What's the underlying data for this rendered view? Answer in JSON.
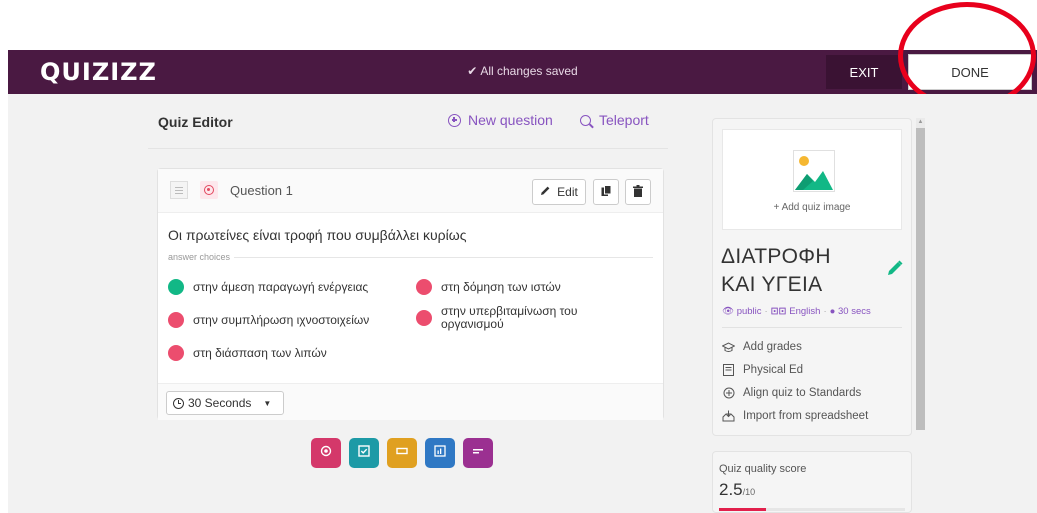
{
  "header": {
    "logo": "QUIZIZZ",
    "save_status": "All changes saved",
    "exit_label": "EXIT",
    "done_label": "DONE"
  },
  "editor": {
    "title": "Quiz Editor",
    "new_question_label": "New question",
    "teleport_label": "Teleport"
  },
  "question": {
    "label": "Question 1",
    "edit_label": "Edit",
    "text": "Οι πρωτείνες είναι τροφή που συμβάλλει κυρίως",
    "answer_choices_label": "answer choices",
    "answers": [
      {
        "text": "στην άμεση παραγωγή ενέργειας",
        "correct": true
      },
      {
        "text": "στη δόμηση των ιστών",
        "correct": false
      },
      {
        "text": "στην συμπλήρωση ιχνοστοιχείων",
        "correct": false
      },
      {
        "text": "στην υπερβιταμίνωση του οργανισμού",
        "correct": false
      },
      {
        "text": "στη διάσπαση των λιπών",
        "correct": false
      }
    ],
    "time_value": "30 Seconds"
  },
  "question_types": [
    {
      "name": "multiple-choice",
      "color": "#d4386a"
    },
    {
      "name": "checkbox",
      "color": "#1d9aa6"
    },
    {
      "name": "fill-in-blank",
      "color": "#e0a020"
    },
    {
      "name": "poll",
      "color": "#2f78c4"
    },
    {
      "name": "open-ended",
      "color": "#9b3091"
    }
  ],
  "sidebar": {
    "add_image_label": "+ Add quiz image",
    "quiz_title": "ΔΙΑΤΡΟΦΗ ΚΑΙ ΥΓΕΙΑ",
    "visibility": "public",
    "language": "English",
    "duration": "30 secs",
    "items": [
      {
        "label": "Add grades",
        "icon": "graduation-cap-icon"
      },
      {
        "label": "Physical Ed",
        "icon": "book-icon"
      },
      {
        "label": "Align quiz to Standards",
        "icon": "circle-plus-icon"
      },
      {
        "label": "Import from spreadsheet",
        "icon": "spreadsheet-import-icon"
      }
    ]
  },
  "quality": {
    "label": "Quiz quality score",
    "score": "2.5",
    "max": "/10",
    "score_fraction": 0.25
  },
  "colors": {
    "topbar": "#4a1942",
    "accent": "#8854c0",
    "correct": "#12b886",
    "wrong": "#ec4d6e",
    "annotation": "#e8001c"
  }
}
